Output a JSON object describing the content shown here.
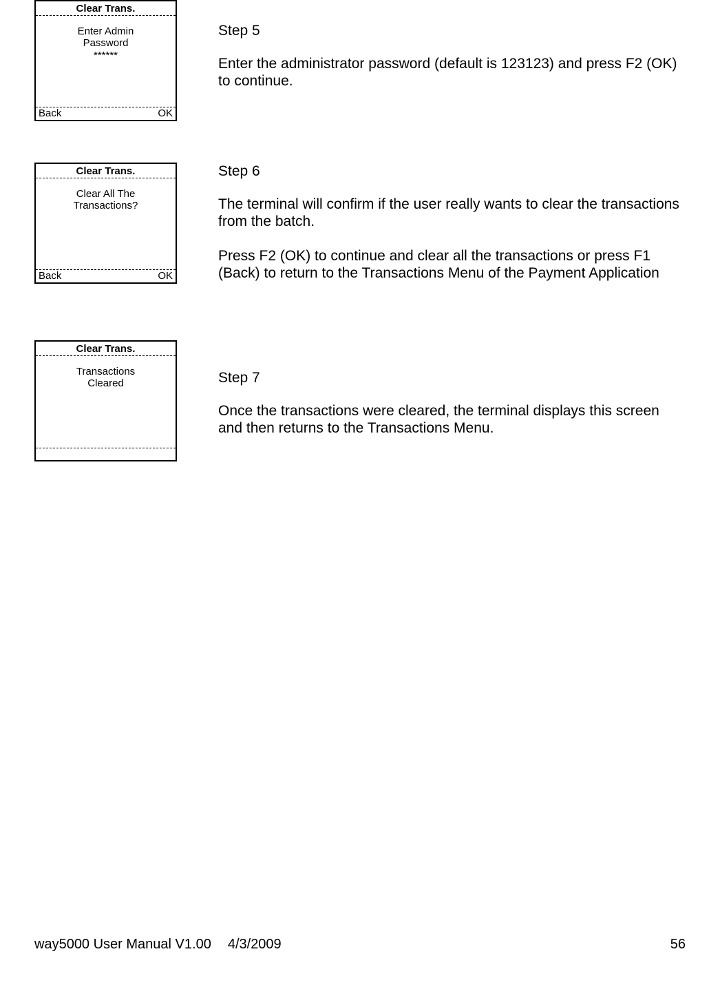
{
  "steps": [
    {
      "terminal": {
        "title": "Clear Trans.",
        "body_lines": [
          "Enter Admin",
          "Password",
          "******"
        ],
        "footer_left": "Back",
        "footer_right": "OK"
      },
      "heading": "Step 5",
      "paragraphs": [
        "Enter the administrator password (default is 123123) and press F2 (OK) to continue."
      ]
    },
    {
      "terminal": {
        "title": "Clear Trans.",
        "body_lines": [
          "Clear All The",
          "Transactions?"
        ],
        "footer_left": "Back",
        "footer_right": "OK"
      },
      "heading": "Step 6",
      "paragraphs": [
        "The terminal will confirm if the user really wants to clear the transactions from the batch.",
        "Press F2 (OK) to continue and clear all the transactions or press F1 (Back) to return to the Transactions Menu of the Payment Application"
      ]
    },
    {
      "terminal": {
        "title": "Clear Trans.",
        "body_lines": [
          "Transactions",
          "Cleared"
        ],
        "footer_left": "",
        "footer_right": ""
      },
      "heading": "Step 7",
      "paragraphs": [
        "Once the transactions were cleared, the terminal displays this screen and then returns to the Transactions Menu."
      ]
    }
  ],
  "footer": {
    "doc": "way5000 User Manual V1.00",
    "date": "4/3/2009",
    "page": "56"
  }
}
